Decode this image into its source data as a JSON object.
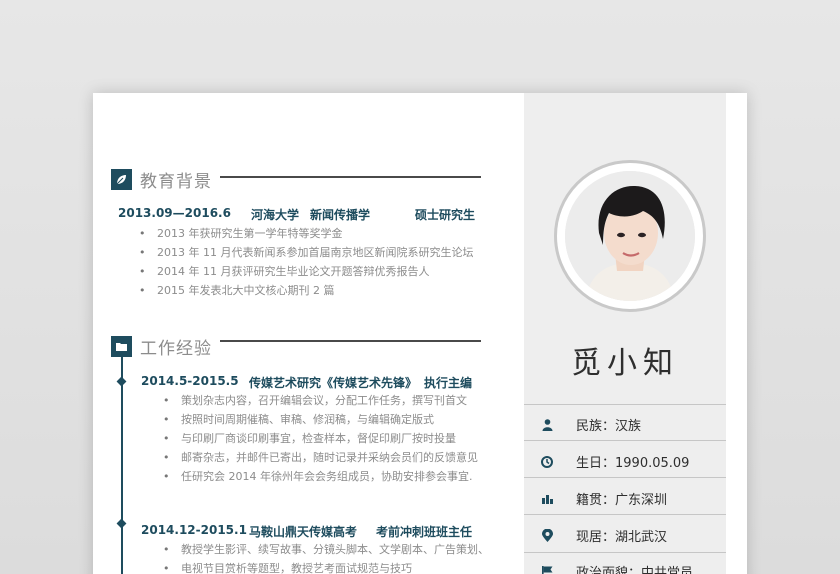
{
  "sections": {
    "education": "教育背景",
    "work": "工作经验"
  },
  "education": {
    "period": "2013.09—2016.6",
    "school": "河海大学",
    "major": "新闻传播学",
    "degree": "硕士研究生",
    "items": [
      "2013 年获研究生第一学年特等奖学金",
      "2013 年 11 月代表新闻系参加首届南京地区新闻院系研究生论坛",
      "2014 年 11 月获评研究生毕业论文开题答辩优秀报告人",
      "2015 年发表北大中文核心期刊 2 篇"
    ]
  },
  "jobs": [
    {
      "period": "2014.5-2015.5",
      "company": "传媒艺术研究《传媒艺术先锋》",
      "role": "执行主编",
      "items": [
        "策划杂志内容，召开编辑会议，分配工作任务，撰写刊首文",
        "按照时间周期催稿、审稿、修润稿，与编辑确定版式",
        "与印刷厂商谈印刷事宜，检查样本，督促印刷厂按时投量",
        "邮寄杂志，并邮件已寄出，随时记录并采纳会员们的反馈意见",
        "任研究会 2014 年徐州年会会务组成员，协助安排参会事宜."
      ]
    },
    {
      "period": "2014.12-2015.1",
      "company": "马鞍山鼎天传媒高考",
      "role": "考前冲刺班班主任",
      "items": [
        "教授学生影评、续写故事、分镜头脚本、文学剧本、广告策划、",
        "电视节目赏析等题型，教授艺考面试规范与技巧"
      ]
    }
  ],
  "profile": {
    "name": "觅小知",
    "info": [
      {
        "icon": "person-icon",
        "label": "民族：汉族"
      },
      {
        "icon": "clock-icon",
        "label": "生日：1990.05.09"
      },
      {
        "icon": "building-icon",
        "label": "籍贯：广东深圳"
      },
      {
        "icon": "location-pin-icon",
        "label": "现居：湖北武汉"
      },
      {
        "icon": "flag-icon",
        "label": "政治面貌：中共党员"
      }
    ]
  },
  "colors": {
    "accent": "#1e4c5e",
    "muted_text": "#8c8c8c",
    "sidebar_bg": "#eeeeee"
  }
}
